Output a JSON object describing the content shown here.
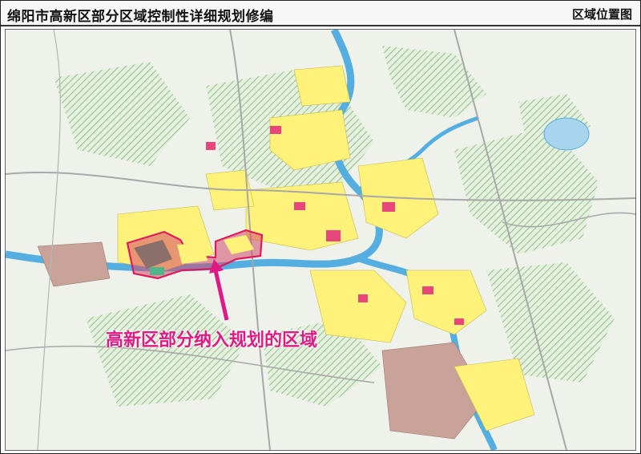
{
  "header": {
    "title": "绵阳市高新区部分区域控制性详细规划修编",
    "subtitle": "区域位置图"
  },
  "map": {
    "annotation": "高新区部分纳入规划的区域",
    "colors": {
      "river": "#55aee0",
      "green_hatch": "#8fbf88",
      "residential": "#fff27a",
      "commercial": "#e8467a",
      "industrial": "#b38c82",
      "highlight_border": "#e0195f",
      "annotation": "#e01a84"
    },
    "icons": [
      "arrow-up-icon"
    ]
  }
}
